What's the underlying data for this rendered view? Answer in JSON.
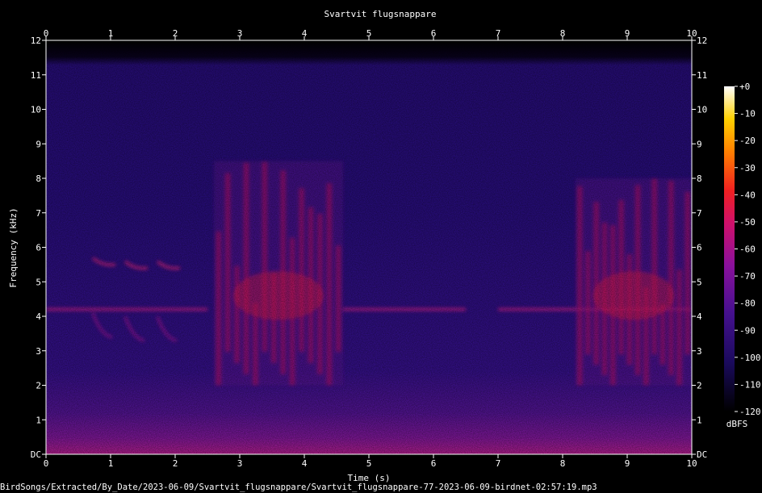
{
  "chart_data": {
    "type": "heatmap",
    "title": "Svartvit flugsnappare",
    "xlabel": "Time (s)",
    "ylabel": "Frequency (kHz)",
    "xlim": [
      0,
      10
    ],
    "ylim": [
      0,
      12
    ],
    "x_ticks": [
      "0",
      "1",
      "2",
      "3",
      "4",
      "5",
      "6",
      "7",
      "8",
      "9",
      "10"
    ],
    "y_ticks": [
      "DC",
      "1",
      "2",
      "3",
      "4",
      "5",
      "6",
      "7",
      "8",
      "9",
      "10",
      "11",
      "12"
    ],
    "colorbar": {
      "label": "dBFS",
      "range": [
        -120,
        0
      ],
      "ticks": [
        "+0",
        "-10",
        "-20",
        "-30",
        "-40",
        "-50",
        "-60",
        "-70",
        "-80",
        "-90",
        "-100",
        "-110",
        "-120"
      ]
    },
    "colors": {
      "low": "#000000",
      "mid_low": "#2a0a6e",
      "mid": "#7a12a0",
      "mid_high": "#e8105a",
      "high": "#ffb000",
      "top": "#ffffff"
    },
    "features": [
      {
        "name": "tonal line",
        "t": [
          0.0,
          2.5
        ],
        "f_khz": 4.2
      },
      {
        "name": "tonal line",
        "t": [
          4.6,
          6.5
        ],
        "f_khz": 4.2
      },
      {
        "name": "tonal line",
        "t": [
          7.0,
          10.0
        ],
        "f_khz": 4.2
      },
      {
        "name": "chirp",
        "t": 0.8,
        "f_khz": 5.5
      },
      {
        "name": "chirp",
        "t": 1.3,
        "f_khz": 5.4
      },
      {
        "name": "chirp",
        "t": 1.8,
        "f_khz": 5.4
      },
      {
        "name": "song burst",
        "t": [
          2.6,
          4.6
        ],
        "f_khz": [
          2.0,
          8.5
        ]
      },
      {
        "name": "song burst",
        "t": [
          8.2,
          10.0
        ],
        "f_khz": [
          2.0,
          8.0
        ]
      }
    ]
  },
  "footer": "BirdSongs/Extracted/By_Date/2023-06-09/Svartvit_flugsnappare/Svartvit_flugsnappare-77-2023-06-09-birdnet-02:57:19.mp3"
}
